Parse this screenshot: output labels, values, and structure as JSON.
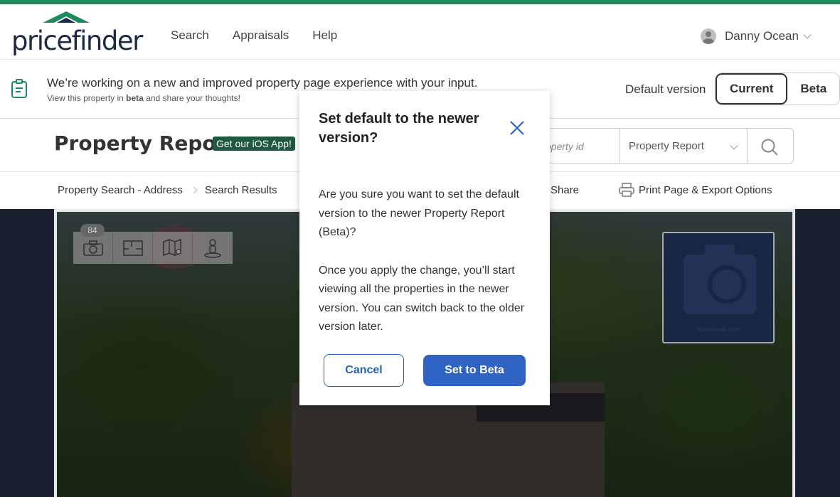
{
  "header": {
    "logo_text": "pricefinder",
    "nav": [
      "Search",
      "Appraisals",
      "Help"
    ],
    "user_name": "Danny Ocean"
  },
  "banner": {
    "title": "We’re working on a new and improved property page experience with your input.",
    "sub_prefix": "View this property in ",
    "sub_bold": "beta",
    "sub_suffix": " and share your thoughts!",
    "default_label": "Default version",
    "options": [
      "Current",
      "Beta"
    ],
    "active_option": "Current"
  },
  "titlerow": {
    "title": "Property Report",
    "ios_badge": "Get our iOS App!",
    "prop_id_placeholder": "operty id",
    "report_select": "Property Report"
  },
  "breadcrumb": {
    "items": [
      "Property Search - Address",
      "Search Results"
    ],
    "share": "Share",
    "print": "Print Page & Export Options"
  },
  "photo": {
    "count": "84",
    "tools": [
      "camera-icon",
      "floorplan-icon",
      "map-icon",
      "streetview-person-icon"
    ],
    "streetview_text": "Streetview Icon"
  },
  "modal": {
    "title": "Set default to the newer version?",
    "body_1": "Are you sure you want to set the default version to the newer Property Report (Beta)?",
    "body_2": "Once you apply the change, you’ll start viewing all the properties in the newer version. You can switch back to the older version later.",
    "cancel": "Cancel",
    "confirm": "Set to Beta"
  },
  "colors": {
    "brand_green": "#1e8a5e",
    "primary_blue": "#2f64c4",
    "logo_navy": "#1c2a47"
  }
}
